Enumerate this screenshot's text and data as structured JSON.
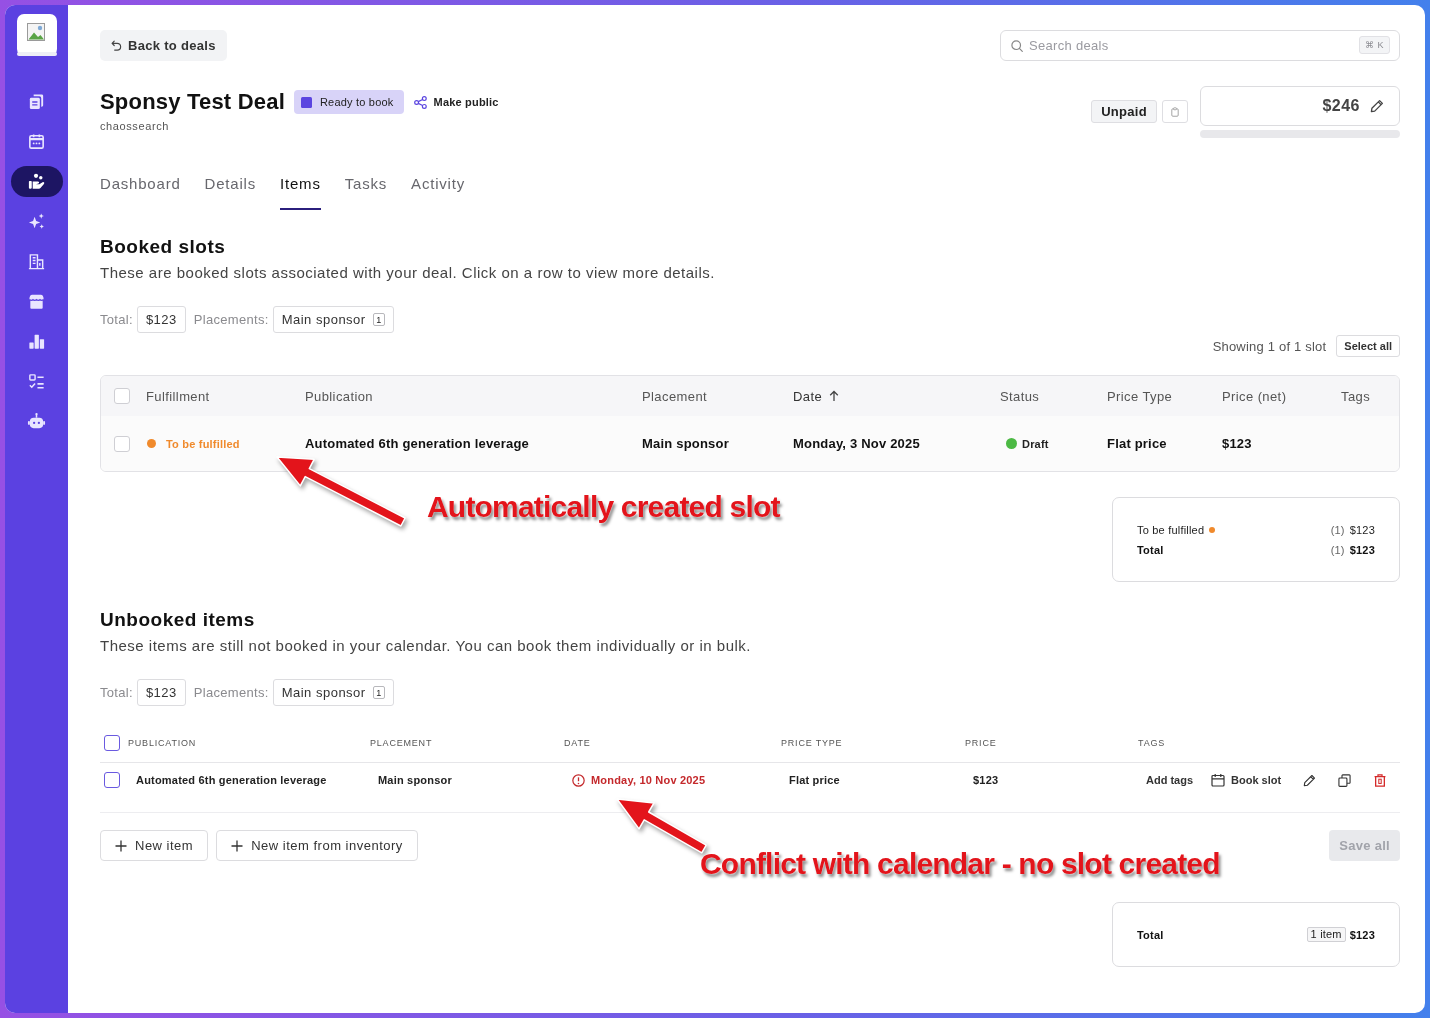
{
  "sidebar": {
    "items": [
      {
        "selected": false
      },
      {
        "selected": false
      },
      {
        "selected": true
      },
      {
        "selected": false
      },
      {
        "selected": false
      },
      {
        "selected": false
      },
      {
        "selected": false
      },
      {
        "selected": false
      },
      {
        "selected": false
      }
    ]
  },
  "header": {
    "back_button": "Back to deals",
    "search": {
      "placeholder": "Search deals",
      "shortcut": "⌘ K"
    },
    "title": "Sponsy Test Deal",
    "status": {
      "label": "Ready to book",
      "color": "#5b45e0"
    },
    "make_public": "Make public",
    "subtitle": "chaossearch",
    "payment_status": "Unpaid",
    "amount": "$246",
    "payment_progress": {
      "level": 0
    }
  },
  "tabs": [
    {
      "label": "Dashboard",
      "selected": false
    },
    {
      "label": "Details",
      "selected": false
    },
    {
      "label": "Items",
      "selected": true
    },
    {
      "label": "Tasks",
      "selected": false
    },
    {
      "label": "Activity",
      "selected": false
    }
  ],
  "booked_slots": {
    "title": "Booked slots",
    "description": "These are booked slots associated with your deal. Click on a row to view more details.",
    "summary": {
      "total_label": "Total:",
      "total": "$123",
      "placements_label": "Placements:",
      "placements": [
        {
          "name": "Main sponsor",
          "count": "1"
        }
      ]
    },
    "showing": "Showing 1 of 1 slot",
    "select_all": "Select all",
    "table": {
      "all_checked": false,
      "columns": [
        {
          "label": "Fulfillment",
          "sorted": false
        },
        {
          "label": "Publication",
          "sorted": false
        },
        {
          "label": "Placement",
          "sorted": false
        },
        {
          "label": "Date",
          "sorted": true
        },
        {
          "label": "Status",
          "sorted": false
        },
        {
          "label": "Price Type",
          "sorted": false
        },
        {
          "label": "Price (net)",
          "sorted": false
        },
        {
          "label": "Tags",
          "sorted": false
        }
      ],
      "rows": [
        {
          "checked": false,
          "fulfillment": {
            "label": "To be fulfilled",
            "color": "#f08a2c"
          },
          "publication": "Automated 6th generation leverage",
          "placement": "Main sponsor",
          "date": "Monday, 3 Nov 2025",
          "status": {
            "label": "Draft",
            "color": "#4cb944"
          },
          "price_type": "Flat price",
          "price": "$123"
        }
      ]
    },
    "totals": [
      {
        "kind": "status",
        "label": "To be fulfilled",
        "color": "#f08a2c",
        "count": "(1)",
        "amount": "$123"
      },
      {
        "kind": "total",
        "label": "Total",
        "count": "(1)",
        "amount": "$123"
      }
    ]
  },
  "unbooked_items": {
    "title": "Unbooked items",
    "description": "These items are still not booked in your calendar. You can book them individually or in bulk.",
    "summary": {
      "total_label": "Total:",
      "total": "$123",
      "placements_label": "Placements:",
      "placements": [
        {
          "name": "Main sponsor",
          "count": "1"
        }
      ]
    },
    "table": {
      "all_checked": false,
      "columns": [
        {
          "label": "PUBLICATION"
        },
        {
          "label": "PLACEMENT"
        },
        {
          "label": "DATE"
        },
        {
          "label": "PRICE TYPE"
        },
        {
          "label": "PRICE"
        },
        {
          "label": "TAGS"
        }
      ],
      "rows": [
        {
          "checked": false,
          "publication": "Automated 6th generation leverage",
          "placement": "Main sponsor",
          "date": {
            "text": "Monday, 10 Nov 2025",
            "conflict": true
          },
          "price_type": "Flat price",
          "price": "$123",
          "add_tags": "Add tags",
          "book_slot": "Book slot"
        }
      ]
    },
    "new_buttons": [
      "New item",
      "New item from inventory"
    ],
    "save": {
      "label": "Save all",
      "disabled": true
    },
    "totals": {
      "label": "Total",
      "count": "1 item",
      "amount": "$123"
    }
  },
  "annotations": [
    {
      "text": "Automatically created slot"
    },
    {
      "text": "Conflict with calendar - no slot created"
    }
  ]
}
